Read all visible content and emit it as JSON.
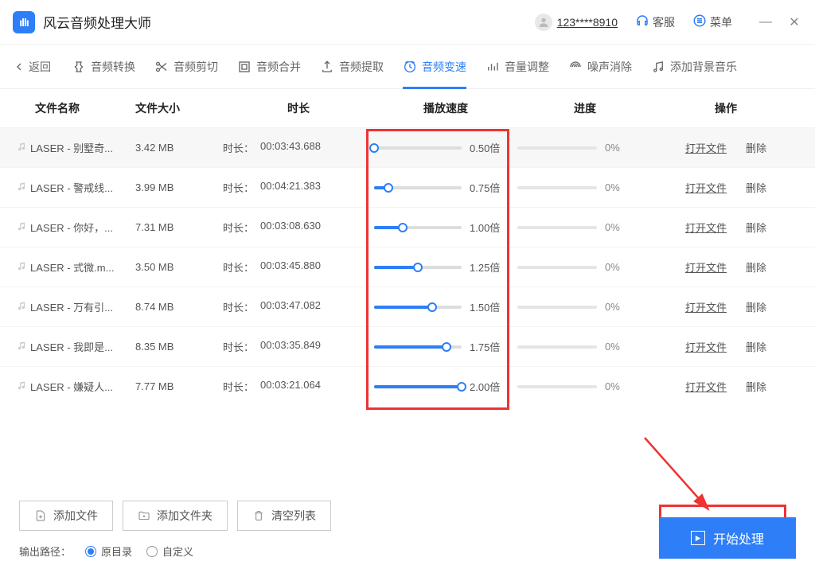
{
  "titlebar": {
    "app_name": "风云音频处理大师",
    "user": "123****8910",
    "support": "客服",
    "menu": "菜单"
  },
  "toolbar": {
    "back": "返回",
    "items": [
      {
        "label": "音频转换"
      },
      {
        "label": "音频剪切"
      },
      {
        "label": "音频合并"
      },
      {
        "label": "音频提取"
      },
      {
        "label": "音频变速"
      },
      {
        "label": "音量调整"
      },
      {
        "label": "噪声消除"
      },
      {
        "label": "添加背景音乐"
      }
    ],
    "active_index": 4
  },
  "table": {
    "headers": {
      "name": "文件名称",
      "size": "文件大小",
      "duration": "时长",
      "speed": "播放速度",
      "progress": "进度",
      "action": "操作"
    },
    "dur_label": "时长：",
    "speed_suffix": "倍",
    "open_label": "打开文件",
    "delete_label": "删除",
    "rows": [
      {
        "name": "LASER - 别墅奇...",
        "size": "3.42 MB",
        "duration": "00:03:43.688",
        "speed": "0.50",
        "speed_pct": 0,
        "progress": "0%"
      },
      {
        "name": "LASER - 警戒线...",
        "size": "3.99 MB",
        "duration": "00:04:21.383",
        "speed": "0.75",
        "speed_pct": 16,
        "progress": "0%"
      },
      {
        "name": "LASER - 你好，...",
        "size": "7.31 MB",
        "duration": "00:03:08.630",
        "speed": "1.00",
        "speed_pct": 33,
        "progress": "0%"
      },
      {
        "name": "LASER - 式微.m...",
        "size": "3.50 MB",
        "duration": "00:03:45.880",
        "speed": "1.25",
        "speed_pct": 50,
        "progress": "0%"
      },
      {
        "name": "LASER - 万有引...",
        "size": "8.74 MB",
        "duration": "00:03:47.082",
        "speed": "1.50",
        "speed_pct": 66,
        "progress": "0%"
      },
      {
        "name": "LASER - 我即是...",
        "size": "8.35 MB",
        "duration": "00:03:35.849",
        "speed": "1.75",
        "speed_pct": 83,
        "progress": "0%"
      },
      {
        "name": "LASER - 嫌疑人...",
        "size": "7.77 MB",
        "duration": "00:03:21.064",
        "speed": "2.00",
        "speed_pct": 100,
        "progress": "0%"
      }
    ]
  },
  "bottom": {
    "add_file": "添加文件",
    "add_folder": "添加文件夹",
    "clear": "清空列表",
    "output_label": "输出路径：",
    "opt_original": "原目录",
    "opt_custom": "自定义",
    "start": "开始处理"
  }
}
